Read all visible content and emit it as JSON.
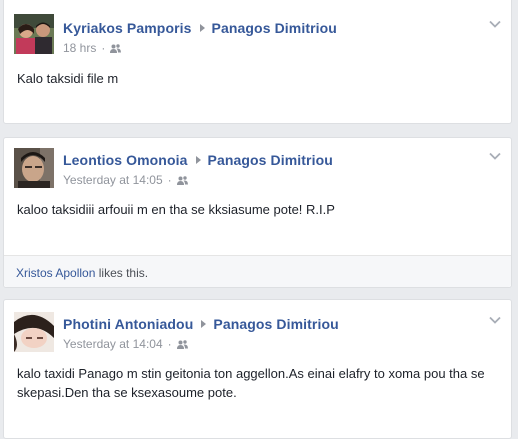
{
  "posts": [
    {
      "author": "Kyriakos Pamporis",
      "target": "Panagos Dimitriou",
      "time": "18 hrs",
      "text": "Kalo taksidi file m"
    },
    {
      "author": "Leontios Omonoia",
      "target": "Panagos Dimitriou",
      "time": "Yesterday at 14:05",
      "text": "kaloo taksidiii arfouii m en tha se kksiasume pote! R.I.P",
      "likes": {
        "liker": "Xristos Apollon",
        "suffix": "likes this."
      }
    },
    {
      "author": "Photini Antoniadou",
      "target": "Panagos Dimitriou",
      "time": "Yesterday at 14:04",
      "text": "kalo taxidi Panago m stin geitonia ton aggellon.As einai elafry to xoma pou tha se skepasi.Den tha se ksexasoume pote."
    }
  ],
  "icons": {
    "audience": "friends-icon",
    "options": "chevron-down-icon",
    "separator": "triangle-right-icon"
  },
  "colors": {
    "link": "#365899",
    "meta": "#90949c",
    "text": "#1d2129",
    "background": "#e9ebee"
  }
}
